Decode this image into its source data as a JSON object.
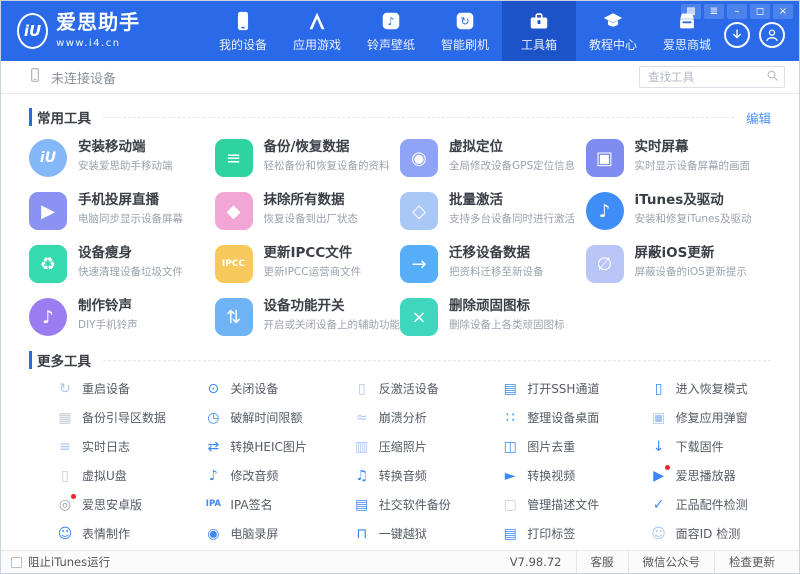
{
  "header": {
    "logo": {
      "monogram": "iU",
      "brand": "爱思助手",
      "site": "www.i4.cn"
    },
    "nav": [
      {
        "label": "我的设备"
      },
      {
        "label": "应用游戏"
      },
      {
        "label": "铃声壁纸"
      },
      {
        "label": "智能刷机"
      },
      {
        "label": "工具箱"
      },
      {
        "label": "教程中心"
      },
      {
        "label": "爱思商城"
      }
    ],
    "controls": [
      {
        "name": "skin",
        "glyph": "▩"
      },
      {
        "name": "menu",
        "glyph": "≣"
      },
      {
        "name": "minimize",
        "glyph": "–"
      },
      {
        "name": "maximize",
        "glyph": "◻"
      },
      {
        "name": "close",
        "glyph": "×"
      }
    ]
  },
  "device_bar": {
    "status": "未连接设备",
    "search_placeholder": "查找工具"
  },
  "sections": {
    "common": {
      "title": "常用工具",
      "edit": "编辑",
      "tools": [
        {
          "title": "安装移动端",
          "subtitle": "安装爱思助手移动端",
          "glyph": "iU",
          "bg": "#85b8f8"
        },
        {
          "title": "备份/恢复数据",
          "subtitle": "轻松备份和恢复设备的资料",
          "glyph": "≡",
          "bg": "#2fd3a0"
        },
        {
          "title": "虚拟定位",
          "subtitle": "全局修改设备GPS定位信息",
          "glyph": "◉",
          "bg": "#8fa4f7"
        },
        {
          "title": "实时屏幕",
          "subtitle": "实时显示设备屏幕的画面",
          "glyph": "▣",
          "bg": "#7e8cf0"
        },
        {
          "title": "手机投屏直播",
          "subtitle": "电脑同步显示设备屏幕",
          "glyph": "▶",
          "bg": "#8a93f2"
        },
        {
          "title": "抹除所有数据",
          "subtitle": "恢复设备到出厂状态",
          "glyph": "◆",
          "bg": "#f2a6d6"
        },
        {
          "title": "批量激活",
          "subtitle": "支持多台设备同时进行激活",
          "glyph": "◇",
          "bg": "#a9c8f5"
        },
        {
          "title": "iTunes及驱动",
          "subtitle": "安装和修复iTunes及驱动",
          "glyph": "♪",
          "bg": "#3f8ef7"
        },
        {
          "title": "设备瘦身",
          "subtitle": "快速清理设备垃圾文件",
          "glyph": "♻",
          "bg": "#35dbae"
        },
        {
          "title": "更新IPCC文件",
          "subtitle": "更新IPCC运营商文件",
          "glyph": "IPCC",
          "bg": "#f7c85c"
        },
        {
          "title": "迁移设备数据",
          "subtitle": "把资料迁移至新设备",
          "glyph": "→",
          "bg": "#57aef8"
        },
        {
          "title": "屏蔽iOS更新",
          "subtitle": "屏蔽设备的iOS更新提示",
          "glyph": "∅",
          "bg": "#b9c4f7"
        },
        {
          "title": "制作铃声",
          "subtitle": "DIY手机铃声",
          "glyph": "♪",
          "bg": "#9a7df0"
        },
        {
          "title": "设备功能开关",
          "subtitle": "开启或关闭设备上的辅助功能",
          "glyph": "⇅",
          "bg": "#6fb3f5"
        },
        {
          "title": "删除顽固图标",
          "subtitle": "删除设备上各类顽固图标",
          "glyph": "×",
          "bg": "#3fd6c0"
        }
      ]
    },
    "more": {
      "title": "更多工具",
      "tools": [
        {
          "label": "重启设备",
          "glyph": "↻",
          "color": "#a9c6f2"
        },
        {
          "label": "关闭设备",
          "glyph": "⊙",
          "color": "#3d87f5"
        },
        {
          "label": "反激活设备",
          "glyph": "▯",
          "color": "#a9c6f2"
        },
        {
          "label": "打开SSH通道",
          "glyph": "▤",
          "color": "#3d87f5"
        },
        {
          "label": "进入恢复模式",
          "glyph": "▯",
          "color": "#3d87f5"
        },
        {
          "label": "备份引导区数据",
          "glyph": "▦",
          "color": "#c6cdd8"
        },
        {
          "label": "破解时间限额",
          "glyph": "◷",
          "color": "#3d87f5"
        },
        {
          "label": "崩溃分析",
          "glyph": "≈",
          "color": "#a9c6f2"
        },
        {
          "label": "整理设备桌面",
          "glyph": "∷",
          "color": "#3d87f5"
        },
        {
          "label": "修复应用弹窗",
          "glyph": "▣",
          "color": "#a9c6f2"
        },
        {
          "label": "实时日志",
          "glyph": "≡",
          "color": "#a9c6f2"
        },
        {
          "label": "转换HEIC图片",
          "glyph": "⇄",
          "color": "#3d87f5"
        },
        {
          "label": "压缩照片",
          "glyph": "▥",
          "color": "#a9c6f2"
        },
        {
          "label": "图片去重",
          "glyph": "◫",
          "color": "#3d87f5"
        },
        {
          "label": "下载固件",
          "glyph": "↓",
          "color": "#3d87f5"
        },
        {
          "label": "虚拟U盘",
          "glyph": "▯",
          "color": "#c6cdd8"
        },
        {
          "label": "修改音频",
          "glyph": "♪",
          "color": "#3d87f5"
        },
        {
          "label": "转换音频",
          "glyph": "♫",
          "color": "#3d87f5"
        },
        {
          "label": "转换视频",
          "glyph": "►",
          "color": "#3d87f5"
        },
        {
          "label": "爱思播放器",
          "glyph": "▶",
          "color": "#3d87f5",
          "badge": true
        },
        {
          "label": "爱思安卓版",
          "glyph": "◎",
          "color": "#9aa2ad",
          "badge": true
        },
        {
          "label": "IPA签名",
          "glyph": "IPA",
          "color": "#3d87f5"
        },
        {
          "label": "社交软件备份",
          "glyph": "▤",
          "color": "#3d87f5"
        },
        {
          "label": "管理描述文件",
          "glyph": "▢",
          "color": "#c6cdd8"
        },
        {
          "label": "正品配件检测",
          "glyph": "✓",
          "color": "#3d87f5"
        },
        {
          "label": "表情制作",
          "glyph": "☺",
          "color": "#3d87f5"
        },
        {
          "label": "电脑录屏",
          "glyph": "◉",
          "color": "#3d87f5"
        },
        {
          "label": "一键越狱",
          "glyph": "⊓",
          "color": "#3d87f5"
        },
        {
          "label": "打印标签",
          "glyph": "▤",
          "color": "#3d87f5"
        },
        {
          "label": "面容ID 检测",
          "glyph": "☺",
          "color": "#a9c6f2"
        }
      ]
    }
  },
  "status_bar": {
    "checkbox_label": "阻止iTunes运行",
    "version": "V7.98.72",
    "links": [
      "客服",
      "微信公众号",
      "检查更新"
    ]
  }
}
